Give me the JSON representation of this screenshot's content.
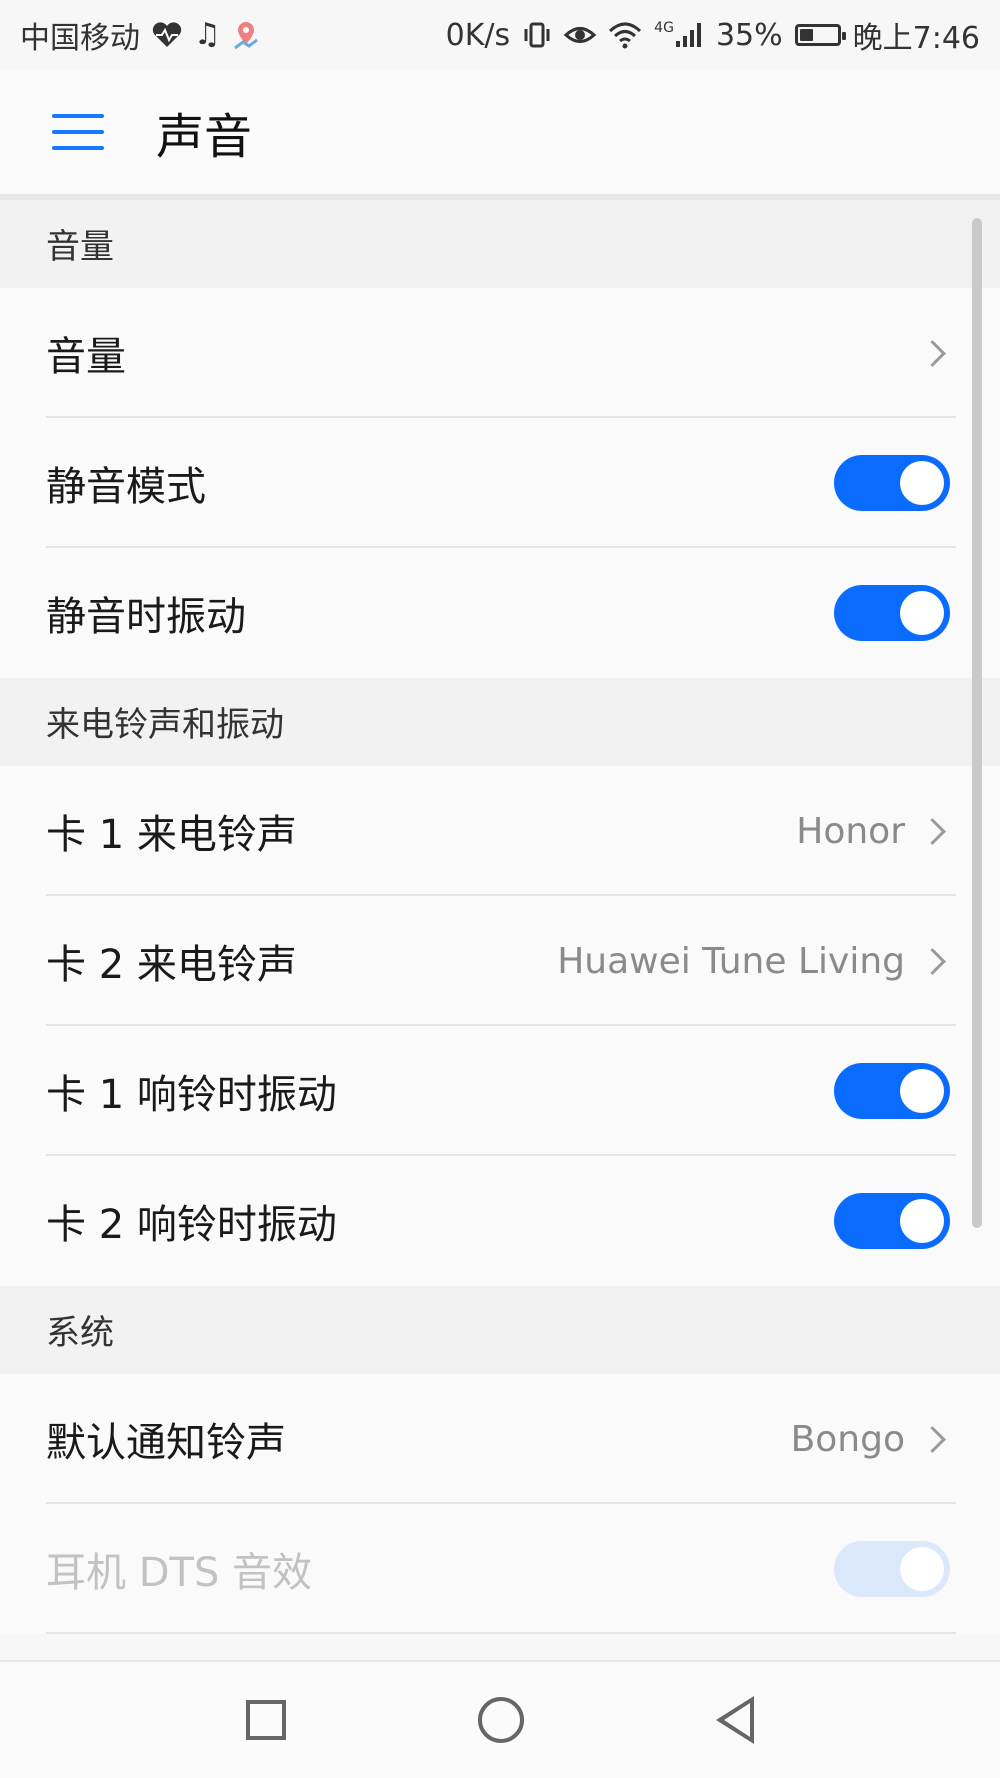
{
  "status_bar": {
    "carrier": "中国移动",
    "speed": "0K/s",
    "network": "4G",
    "battery_percent": "35%",
    "battery_level": 0.35,
    "time": "晚上7:46",
    "icons": [
      "heartbeat-icon",
      "music-note-icon",
      "map-icon",
      "vibrate-icon",
      "eye-icon",
      "wifi-icon",
      "signal-icon",
      "battery-icon"
    ]
  },
  "app_bar": {
    "title": "声音"
  },
  "sections": {
    "volume": {
      "header": "音量",
      "rows": [
        {
          "label": "音量",
          "type": "link"
        },
        {
          "label": "静音模式",
          "type": "toggle",
          "on": true
        },
        {
          "label": "静音时振动",
          "type": "toggle",
          "on": true
        }
      ]
    },
    "ringtone": {
      "header": "来电铃声和振动",
      "rows": [
        {
          "label": "卡 1 来电铃声",
          "value": "Honor",
          "type": "link"
        },
        {
          "label": "卡 2 来电铃声",
          "value": "Huawei Tune Living",
          "type": "link"
        },
        {
          "label": "卡 1 响铃时振动",
          "type": "toggle",
          "on": true
        },
        {
          "label": "卡 2 响铃时振动",
          "type": "toggle",
          "on": true
        }
      ]
    },
    "system": {
      "header": "系统",
      "rows": [
        {
          "label": "默认通知铃声",
          "value": "Bongo",
          "type": "link"
        },
        {
          "label": "耳机 DTS 音效",
          "type": "toggle",
          "on": true,
          "disabled": true
        }
      ]
    }
  },
  "colors": {
    "accent": "#0a6cff",
    "disabled_toggle": "#dbe8fb"
  }
}
